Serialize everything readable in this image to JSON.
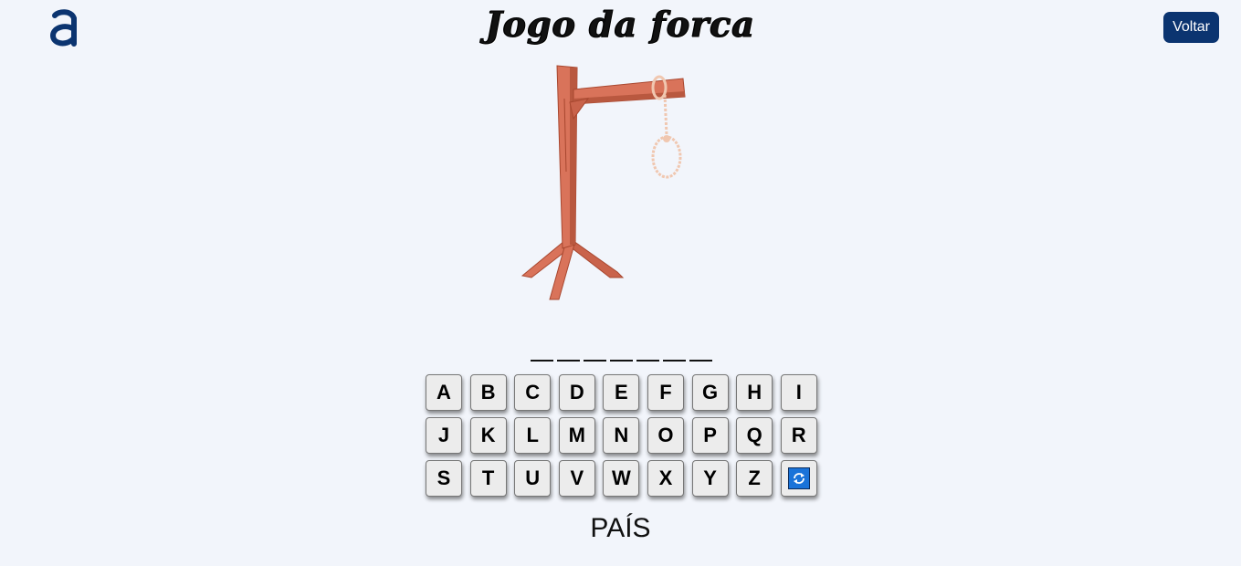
{
  "header": {
    "title": "Jogo da forca",
    "back_label": "Voltar"
  },
  "game": {
    "word_length": 7,
    "revealed": [
      "",
      "",
      "",
      "",
      "",
      "",
      ""
    ],
    "hint": "PAÍS",
    "keys": [
      "A",
      "B",
      "C",
      "D",
      "E",
      "F",
      "G",
      "H",
      "I",
      "J",
      "K",
      "L",
      "M",
      "N",
      "O",
      "P",
      "Q",
      "R",
      "S",
      "T",
      "U",
      "V",
      "W",
      "X",
      "Y",
      "Z"
    ],
    "restart_icon": "refresh-icon"
  },
  "colors": {
    "accent": "#0b3470",
    "background": "#f2f5fb",
    "wood": "#d9735a",
    "restart": "#1a73d9"
  }
}
